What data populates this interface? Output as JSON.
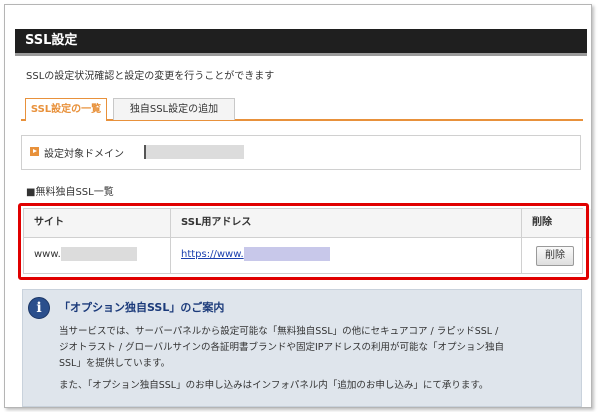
{
  "header": {
    "title": "SSL設定"
  },
  "description": "SSLの設定状況確認と設定の変更を行うことができます",
  "tabs": [
    {
      "label": "SSL設定の一覧",
      "active": true
    },
    {
      "label": "独自SSL設定の追加",
      "active": false
    }
  ],
  "domain": {
    "label": "設定対象ドメイン",
    "value": "[redacted]"
  },
  "section_label": "■無料独自SSL一覧",
  "table": {
    "headers": [
      "サイト",
      "SSL用アドレス",
      "削除"
    ],
    "rows": [
      {
        "site": "www.",
        "address": "https://www.",
        "delete_label": "削除"
      }
    ]
  },
  "info": {
    "title": "「オプション独自SSL」のご案内",
    "paragraph1_line1": "当サービスでは、サーバーパネルから設定可能な「無料独自SSL」の他にセキュアコア / ラピッドSSL /",
    "paragraph1_line2": "ジオトラスト / グローバルサインの各証明書ブランドや固定IPアドレスの利用が可能な「オプション独自",
    "paragraph1_line3": "SSL」を提供しています。",
    "paragraph2": "また、「オプション独自SSL」のお申し込みはインフォパネル内「追加のお申し込み」にて承ります。"
  },
  "colors": {
    "header_bg": "#1f1f1f",
    "accent_orange": "#e8913b",
    "highlight_red": "#e00000",
    "link_blue": "#1a3fae",
    "info_bg": "#dfe5ec"
  },
  "icons": {
    "domain_bullet": "orange-triangle-bullet-icon",
    "info": "info-circle-icon"
  }
}
